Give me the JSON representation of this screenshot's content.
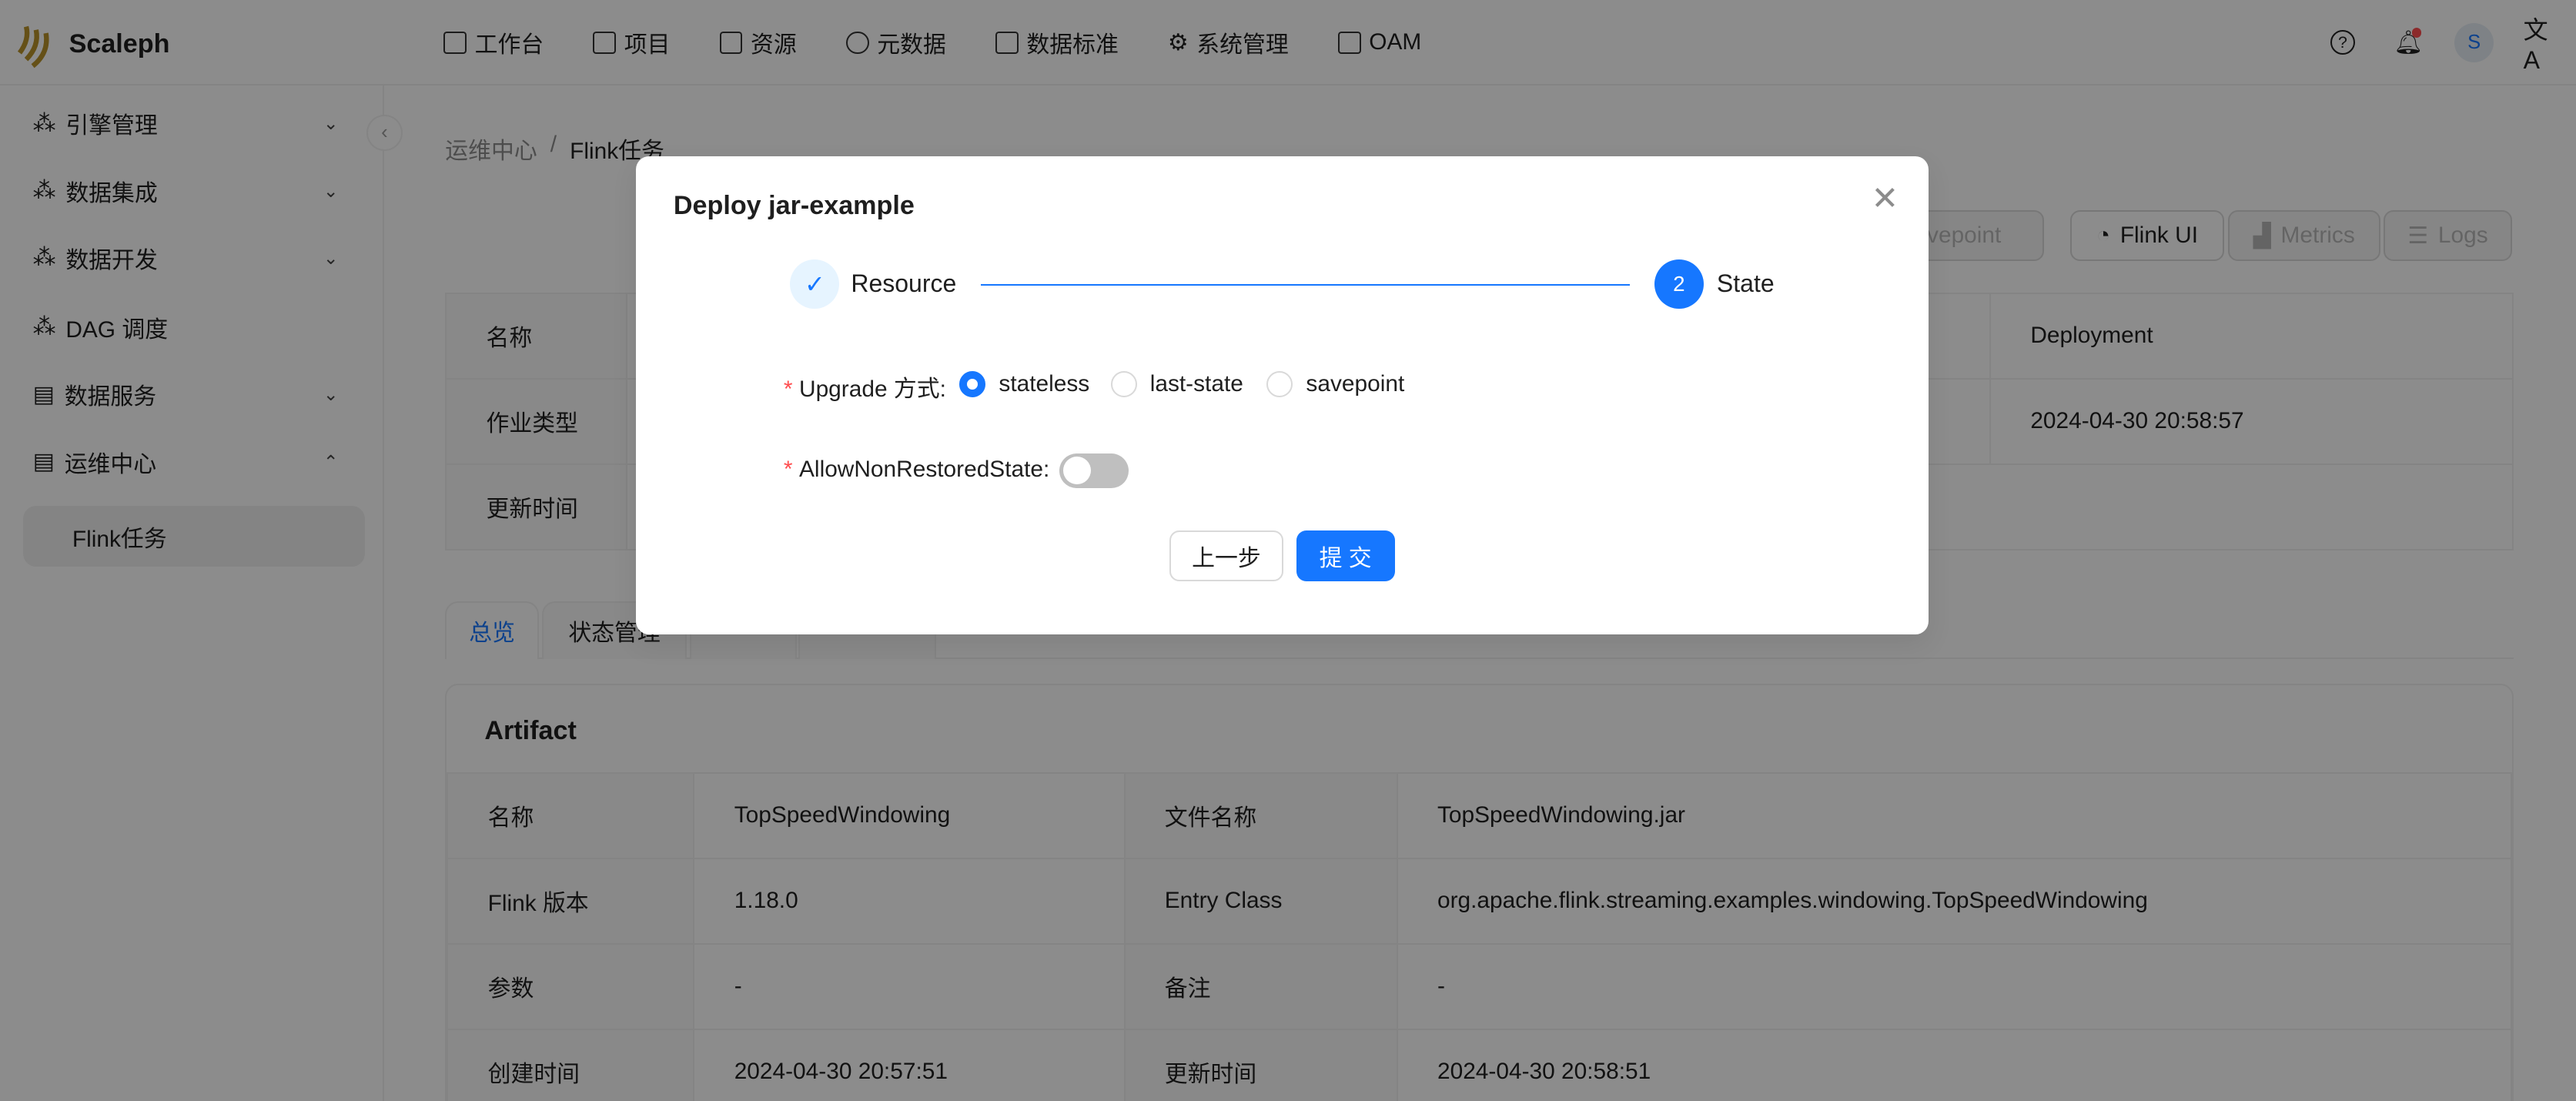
{
  "header": {
    "brand": "Scaleph",
    "nav": [
      {
        "label": "工作台",
        "icon": "cube-icon"
      },
      {
        "label": "项目",
        "icon": "project-icon"
      },
      {
        "label": "资源",
        "icon": "file-icon"
      },
      {
        "label": "元数据",
        "icon": "compass-icon"
      },
      {
        "label": "数据标准",
        "icon": "database-icon"
      },
      {
        "label": "系统管理",
        "icon": "gear-icon"
      },
      {
        "label": "OAM",
        "icon": "wallet-icon"
      }
    ],
    "avatar": "S",
    "accent": "#1677ff"
  },
  "sidebar": {
    "items": [
      {
        "label": "引擎管理"
      },
      {
        "label": "数据集成"
      },
      {
        "label": "数据开发"
      },
      {
        "label": "DAG 调度"
      },
      {
        "label": "数据服务"
      },
      {
        "label": "运维中心"
      }
    ],
    "selected": "Flink任务"
  },
  "breadcrumb": [
    "运维中心",
    "/",
    "Flink任务"
  ],
  "toolbar": {
    "savepoint": "Savepoint",
    "flink_ui": "Flink UI",
    "metrics": "Metrics",
    "logs": "Logs"
  },
  "job_info": {
    "rows": [
      {
        "label": "名称",
        "value": "Deployment"
      },
      {
        "label": "作业类型",
        "value": "2024-04-30 20:58:57"
      },
      {
        "label": "更新时间",
        "value": ""
      }
    ]
  },
  "tabs": [
    "总览",
    "状态管理"
  ],
  "artifact": {
    "title": "Artifact",
    "rows": [
      [
        "名称",
        "TopSpeedWindowing",
        "文件名称",
        "TopSpeedWindowing.jar"
      ],
      [
        "Flink 版本",
        "1.18.0",
        "Entry Class",
        "org.apache.flink.streaming.examples.windowing.TopSpeedWindowing"
      ],
      [
        "参数",
        "-",
        "备注",
        "-"
      ],
      [
        "创建时间",
        "2024-04-30 20:57:51",
        "更新时间",
        "2024-04-30 20:58:51"
      ]
    ]
  },
  "modal": {
    "title": "Deploy jar-example",
    "steps": [
      {
        "label": "Resource",
        "status": "finished"
      },
      {
        "label": "State",
        "number": "2",
        "status": "current"
      }
    ],
    "upgrade_label": "Upgrade 方式:",
    "upgrade_options": [
      "stateless",
      "last-state",
      "savepoint"
    ],
    "upgrade_selected": "stateless",
    "allow_label": "AllowNonRestoredState:",
    "allow_value": false,
    "prev": "上一步",
    "submit": "提 交"
  }
}
